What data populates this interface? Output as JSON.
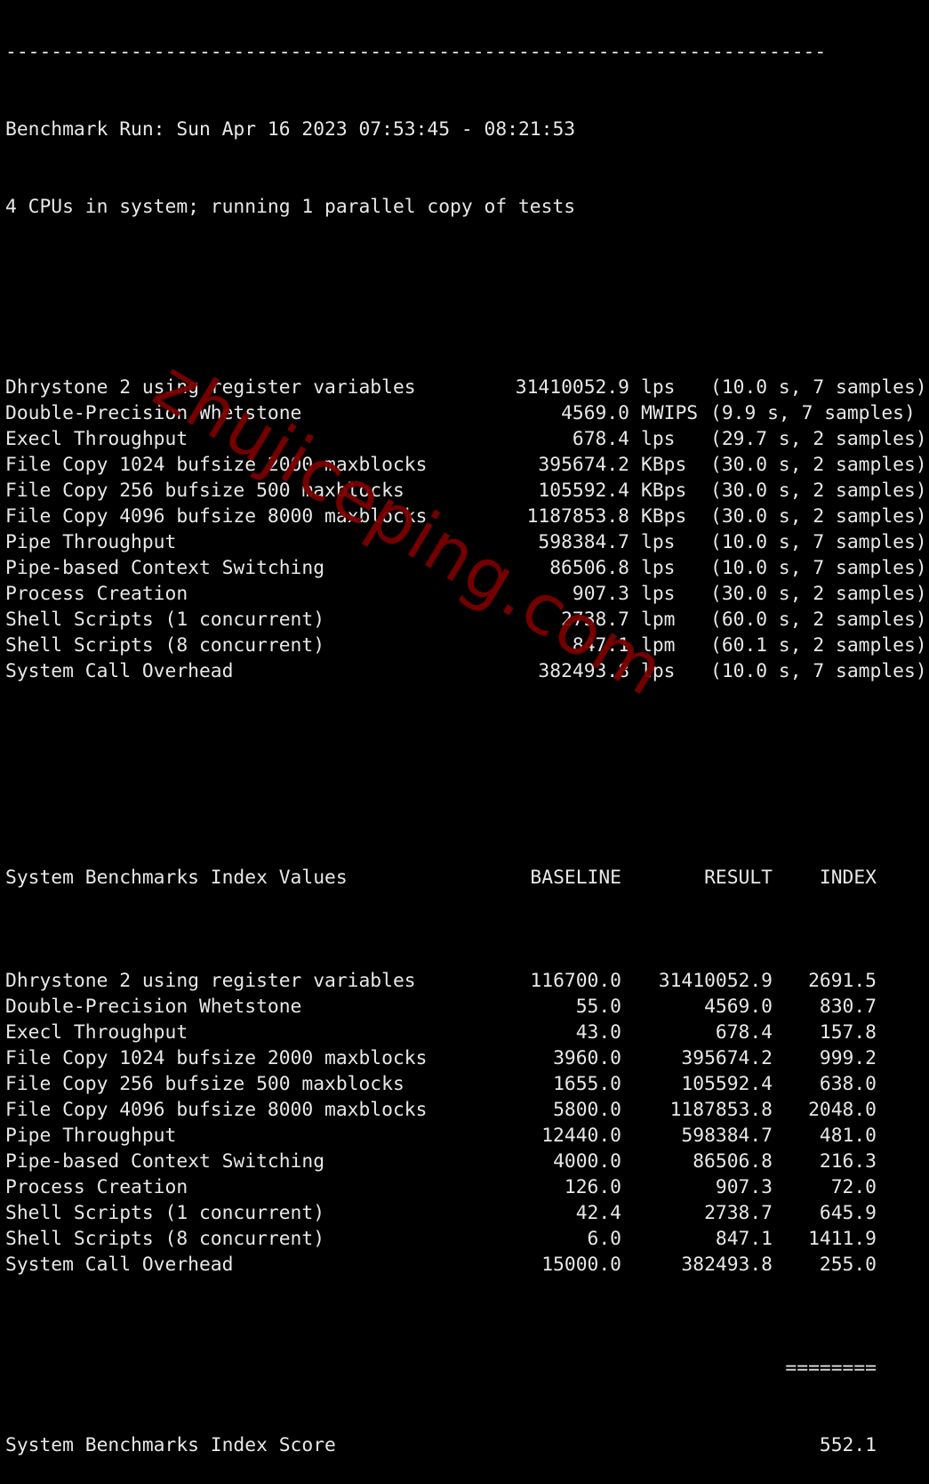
{
  "terminal": {
    "separator": "------------------------------------------------------------------------",
    "run_header": "Benchmark Run: Sun Apr 16 2023 07:53:45 - 08:21:53",
    "cpu_info": "4 CPUs in system; running 1 parallel copy of tests",
    "results": [
      {
        "name": "Dhrystone 2 using register variables",
        "value": "31410052.9",
        "unit": "lps",
        "detail": "(10.0 s, 7 samples)"
      },
      {
        "name": "Double-Precision Whetstone",
        "value": "4569.0",
        "unit": "MWIPS",
        "detail": "(9.9 s, 7 samples)"
      },
      {
        "name": "Execl Throughput",
        "value": "678.4",
        "unit": "lps",
        "detail": "(29.7 s, 2 samples)"
      },
      {
        "name": "File Copy 1024 bufsize 2000 maxblocks",
        "value": "395674.2",
        "unit": "KBps",
        "detail": "(30.0 s, 2 samples)"
      },
      {
        "name": "File Copy 256 bufsize 500 maxblocks",
        "value": "105592.4",
        "unit": "KBps",
        "detail": "(30.0 s, 2 samples)"
      },
      {
        "name": "File Copy 4096 bufsize 8000 maxblocks",
        "value": "1187853.8",
        "unit": "KBps",
        "detail": "(30.0 s, 2 samples)"
      },
      {
        "name": "Pipe Throughput",
        "value": "598384.7",
        "unit": "lps",
        "detail": "(10.0 s, 7 samples)"
      },
      {
        "name": "Pipe-based Context Switching",
        "value": "86506.8",
        "unit": "lps",
        "detail": "(10.0 s, 7 samples)"
      },
      {
        "name": "Process Creation",
        "value": "907.3",
        "unit": "lps",
        "detail": "(30.0 s, 2 samples)"
      },
      {
        "name": "Shell Scripts (1 concurrent)",
        "value": "2738.7",
        "unit": "lpm",
        "detail": "(60.0 s, 2 samples)"
      },
      {
        "name": "Shell Scripts (8 concurrent)",
        "value": "847.1",
        "unit": "lpm",
        "detail": "(60.1 s, 2 samples)"
      },
      {
        "name": "System Call Overhead",
        "value": "382493.8",
        "unit": "lps",
        "detail": "(10.0 s, 7 samples)"
      }
    ],
    "index_table": {
      "title": "System Benchmarks Index Values",
      "headers": {
        "baseline": "BASELINE",
        "result": "RESULT",
        "index": "INDEX"
      },
      "rows": [
        {
          "name": "Dhrystone 2 using register variables",
          "baseline": "116700.0",
          "result": "31410052.9",
          "index": "2691.5"
        },
        {
          "name": "Double-Precision Whetstone",
          "baseline": "55.0",
          "result": "4569.0",
          "index": "830.7"
        },
        {
          "name": "Execl Throughput",
          "baseline": "43.0",
          "result": "678.4",
          "index": "157.8"
        },
        {
          "name": "File Copy 1024 bufsize 2000 maxblocks",
          "baseline": "3960.0",
          "result": "395674.2",
          "index": "999.2"
        },
        {
          "name": "File Copy 256 bufsize 500 maxblocks",
          "baseline": "1655.0",
          "result": "105592.4",
          "index": "638.0"
        },
        {
          "name": "File Copy 4096 bufsize 8000 maxblocks",
          "baseline": "5800.0",
          "result": "1187853.8",
          "index": "2048.0"
        },
        {
          "name": "Pipe Throughput",
          "baseline": "12440.0",
          "result": "598384.7",
          "index": "481.0"
        },
        {
          "name": "Pipe-based Context Switching",
          "baseline": "4000.0",
          "result": "86506.8",
          "index": "216.3"
        },
        {
          "name": "Process Creation",
          "baseline": "126.0",
          "result": "907.3",
          "index": "72.0"
        },
        {
          "name": "Shell Scripts (1 concurrent)",
          "baseline": "42.4",
          "result": "2738.7",
          "index": "645.9"
        },
        {
          "name": "Shell Scripts (8 concurrent)",
          "baseline": "6.0",
          "result": "847.1",
          "index": "1411.9"
        },
        {
          "name": "System Call Overhead",
          "baseline": "15000.0",
          "result": "382493.8",
          "index": "255.0"
        }
      ],
      "total_separator": "========",
      "score_label": "System Benchmarks Index Score",
      "score_value": "552.1"
    }
  },
  "watermark": {
    "text": "zhujiceping.com",
    "color": "#7a0000"
  },
  "colors": {
    "background": "#000000",
    "foreground": "#e8e8e8"
  }
}
